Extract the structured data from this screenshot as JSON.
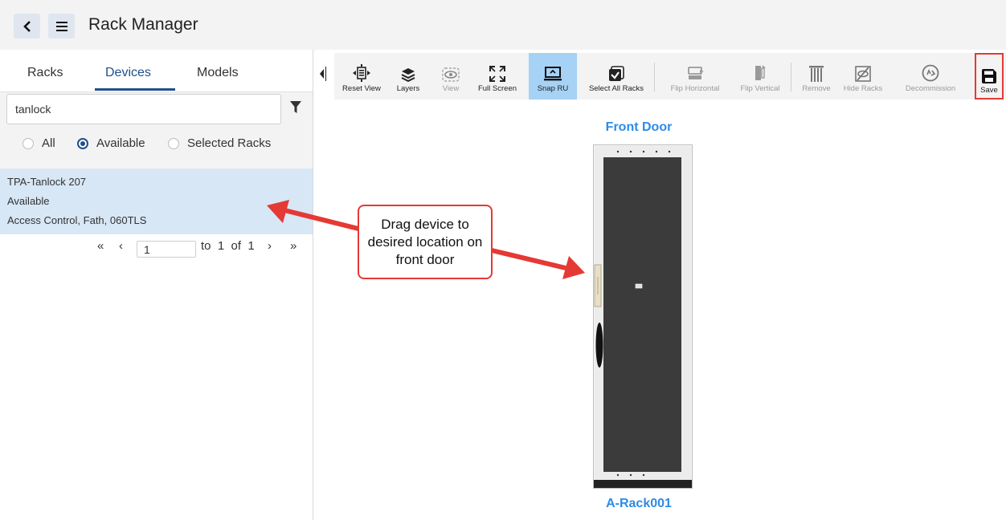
{
  "app": {
    "title": "Rack Manager",
    "back_icon": "chevron-left-icon",
    "menu_icon": "hamburger-icon"
  },
  "tabs": [
    {
      "label": "Racks",
      "active": false
    },
    {
      "label": "Devices",
      "active": true
    },
    {
      "label": "Models",
      "active": false
    }
  ],
  "search": {
    "value": "tanlock",
    "icon": "filter-icon"
  },
  "filters": [
    {
      "label": "All",
      "selected": false
    },
    {
      "label": "Available",
      "selected": true
    },
    {
      "label": "Selected Racks",
      "selected": false
    }
  ],
  "devices": [
    {
      "name": "TPA-Tanlock 207",
      "status": "Available",
      "details": "Access Control, Fath, 060TLS"
    }
  ],
  "pagination": {
    "first": "«",
    "prev": "‹",
    "page": "1",
    "range_text": "to  1  of  1",
    "next": "›",
    "last": "»"
  },
  "toolbar": [
    {
      "label": "Reset View",
      "icon": "reset-view-icon",
      "enabled": true
    },
    {
      "label": "Layers",
      "icon": "layers-icon",
      "enabled": true
    },
    {
      "label": "View",
      "icon": "eye-icon",
      "enabled": false
    },
    {
      "label": "Full Screen",
      "icon": "fullscreen-icon",
      "enabled": true
    },
    {
      "label": "Snap RU",
      "icon": "snap-ru-icon",
      "enabled": true,
      "active": true
    },
    {
      "label": "Select All Racks",
      "icon": "select-all-icon",
      "enabled": true
    },
    {
      "label": "Flip Horizontal",
      "icon": "flip-horizontal-icon",
      "enabled": false
    },
    {
      "label": "Flip Vertical",
      "icon": "flip-vertical-icon",
      "enabled": false
    },
    {
      "label": "Remove",
      "icon": "remove-icon",
      "enabled": false
    },
    {
      "label": "Hide Racks",
      "icon": "hide-racks-icon",
      "enabled": false
    },
    {
      "label": "Decommission",
      "icon": "decommission-icon",
      "enabled": false
    },
    {
      "label": "Save",
      "icon": "save-icon",
      "enabled": true,
      "highlighted": true
    }
  ],
  "canvas": {
    "front_door_label": "Front Door",
    "rack_name": "A-Rack001",
    "callout_text": "Drag device to desired location on front door"
  },
  "colors": {
    "accent": "#1f4f8b",
    "label_blue": "#2e8be6",
    "callout_red": "#e53935",
    "selected_row": "#d7e7f6",
    "active_tool": "#a6d2f5"
  }
}
